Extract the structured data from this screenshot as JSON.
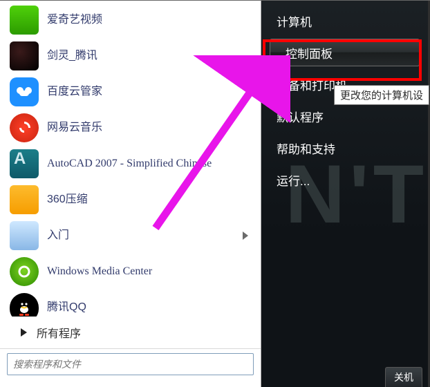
{
  "left_panel": {
    "apps": [
      {
        "label": "爱奇艺视频",
        "icon": "iqiyi-icon",
        "has_expand": false
      },
      {
        "label": "剑灵_腾讯",
        "icon": "blade-soul-icon",
        "has_expand": false
      },
      {
        "label": "百度云管家",
        "icon": "baidu-cloud-icon",
        "has_expand": false
      },
      {
        "label": "网易云音乐",
        "icon": "netease-music-icon",
        "has_expand": false
      },
      {
        "label": "AutoCAD 2007 - Simplified Chinese",
        "icon": "autocad-icon",
        "has_expand": false
      },
      {
        "label": "360压缩",
        "icon": "360zip-icon",
        "has_expand": false
      },
      {
        "label": "入门",
        "icon": "getting-started-icon",
        "has_expand": true
      },
      {
        "label": "Windows Media Center",
        "icon": "wmc-icon",
        "has_expand": false
      },
      {
        "label": "腾讯QQ",
        "icon": "qq-icon",
        "has_expand": false
      }
    ],
    "all_programs_label": "所有程序",
    "search_placeholder": "搜索程序和文件"
  },
  "right_panel": {
    "items": [
      {
        "label": "计算机",
        "highlighted": false
      },
      {
        "label": "控制面板",
        "highlighted": true
      },
      {
        "label": "设备和打印机",
        "highlighted": false
      },
      {
        "label": "默认程序",
        "highlighted": false
      },
      {
        "label": "帮助和支持",
        "highlighted": false
      },
      {
        "label": "运行...",
        "highlighted": false
      }
    ],
    "bottom_button": "关机"
  },
  "tooltip_text": "更改您的计算机设",
  "annotation": {
    "highlight_color": "#ff0000",
    "arrow_color": "#e815ea"
  }
}
